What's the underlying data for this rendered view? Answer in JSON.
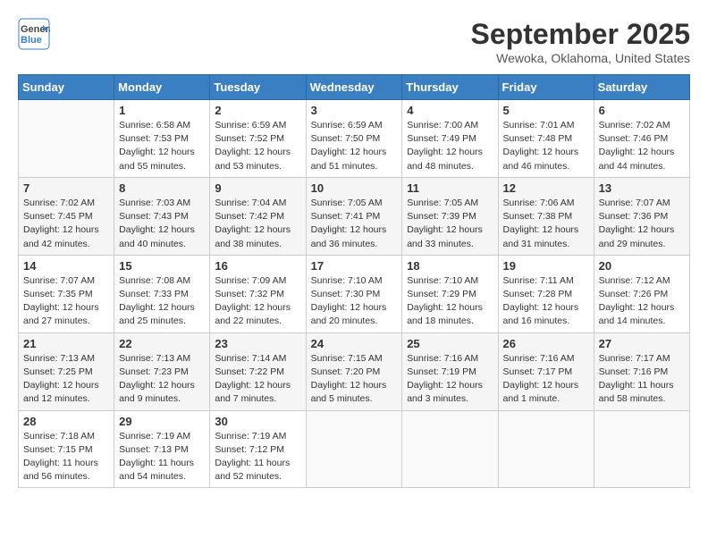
{
  "header": {
    "logo_general": "General",
    "logo_blue": "Blue",
    "month_title": "September 2025",
    "location": "Wewoka, Oklahoma, United States"
  },
  "weekdays": [
    "Sunday",
    "Monday",
    "Tuesday",
    "Wednesday",
    "Thursday",
    "Friday",
    "Saturday"
  ],
  "weeks": [
    [
      {
        "day": "",
        "info": ""
      },
      {
        "day": "1",
        "info": "Sunrise: 6:58 AM\nSunset: 7:53 PM\nDaylight: 12 hours\nand 55 minutes."
      },
      {
        "day": "2",
        "info": "Sunrise: 6:59 AM\nSunset: 7:52 PM\nDaylight: 12 hours\nand 53 minutes."
      },
      {
        "day": "3",
        "info": "Sunrise: 6:59 AM\nSunset: 7:50 PM\nDaylight: 12 hours\nand 51 minutes."
      },
      {
        "day": "4",
        "info": "Sunrise: 7:00 AM\nSunset: 7:49 PM\nDaylight: 12 hours\nand 48 minutes."
      },
      {
        "day": "5",
        "info": "Sunrise: 7:01 AM\nSunset: 7:48 PM\nDaylight: 12 hours\nand 46 minutes."
      },
      {
        "day": "6",
        "info": "Sunrise: 7:02 AM\nSunset: 7:46 PM\nDaylight: 12 hours\nand 44 minutes."
      }
    ],
    [
      {
        "day": "7",
        "info": "Sunrise: 7:02 AM\nSunset: 7:45 PM\nDaylight: 12 hours\nand 42 minutes."
      },
      {
        "day": "8",
        "info": "Sunrise: 7:03 AM\nSunset: 7:43 PM\nDaylight: 12 hours\nand 40 minutes."
      },
      {
        "day": "9",
        "info": "Sunrise: 7:04 AM\nSunset: 7:42 PM\nDaylight: 12 hours\nand 38 minutes."
      },
      {
        "day": "10",
        "info": "Sunrise: 7:05 AM\nSunset: 7:41 PM\nDaylight: 12 hours\nand 36 minutes."
      },
      {
        "day": "11",
        "info": "Sunrise: 7:05 AM\nSunset: 7:39 PM\nDaylight: 12 hours\nand 33 minutes."
      },
      {
        "day": "12",
        "info": "Sunrise: 7:06 AM\nSunset: 7:38 PM\nDaylight: 12 hours\nand 31 minutes."
      },
      {
        "day": "13",
        "info": "Sunrise: 7:07 AM\nSunset: 7:36 PM\nDaylight: 12 hours\nand 29 minutes."
      }
    ],
    [
      {
        "day": "14",
        "info": "Sunrise: 7:07 AM\nSunset: 7:35 PM\nDaylight: 12 hours\nand 27 minutes."
      },
      {
        "day": "15",
        "info": "Sunrise: 7:08 AM\nSunset: 7:33 PM\nDaylight: 12 hours\nand 25 minutes."
      },
      {
        "day": "16",
        "info": "Sunrise: 7:09 AM\nSunset: 7:32 PM\nDaylight: 12 hours\nand 22 minutes."
      },
      {
        "day": "17",
        "info": "Sunrise: 7:10 AM\nSunset: 7:30 PM\nDaylight: 12 hours\nand 20 minutes."
      },
      {
        "day": "18",
        "info": "Sunrise: 7:10 AM\nSunset: 7:29 PM\nDaylight: 12 hours\nand 18 minutes."
      },
      {
        "day": "19",
        "info": "Sunrise: 7:11 AM\nSunset: 7:28 PM\nDaylight: 12 hours\nand 16 minutes."
      },
      {
        "day": "20",
        "info": "Sunrise: 7:12 AM\nSunset: 7:26 PM\nDaylight: 12 hours\nand 14 minutes."
      }
    ],
    [
      {
        "day": "21",
        "info": "Sunrise: 7:13 AM\nSunset: 7:25 PM\nDaylight: 12 hours\nand 12 minutes."
      },
      {
        "day": "22",
        "info": "Sunrise: 7:13 AM\nSunset: 7:23 PM\nDaylight: 12 hours\nand 9 minutes."
      },
      {
        "day": "23",
        "info": "Sunrise: 7:14 AM\nSunset: 7:22 PM\nDaylight: 12 hours\nand 7 minutes."
      },
      {
        "day": "24",
        "info": "Sunrise: 7:15 AM\nSunset: 7:20 PM\nDaylight: 12 hours\nand 5 minutes."
      },
      {
        "day": "25",
        "info": "Sunrise: 7:16 AM\nSunset: 7:19 PM\nDaylight: 12 hours\nand 3 minutes."
      },
      {
        "day": "26",
        "info": "Sunrise: 7:16 AM\nSunset: 7:17 PM\nDaylight: 12 hours\nand 1 minute."
      },
      {
        "day": "27",
        "info": "Sunrise: 7:17 AM\nSunset: 7:16 PM\nDaylight: 11 hours\nand 58 minutes."
      }
    ],
    [
      {
        "day": "28",
        "info": "Sunrise: 7:18 AM\nSunset: 7:15 PM\nDaylight: 11 hours\nand 56 minutes."
      },
      {
        "day": "29",
        "info": "Sunrise: 7:19 AM\nSunset: 7:13 PM\nDaylight: 11 hours\nand 54 minutes."
      },
      {
        "day": "30",
        "info": "Sunrise: 7:19 AM\nSunset: 7:12 PM\nDaylight: 11 hours\nand 52 minutes."
      },
      {
        "day": "",
        "info": ""
      },
      {
        "day": "",
        "info": ""
      },
      {
        "day": "",
        "info": ""
      },
      {
        "day": "",
        "info": ""
      }
    ]
  ]
}
